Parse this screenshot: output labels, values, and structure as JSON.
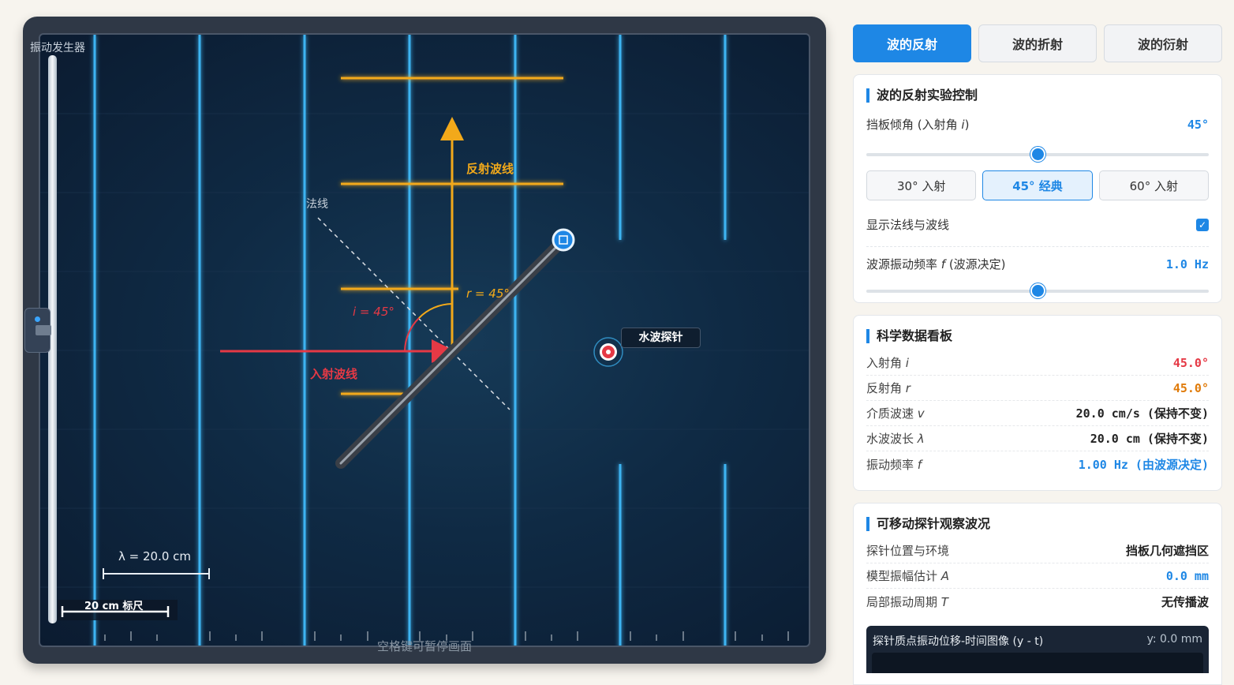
{
  "tank": {
    "generator_label": "振动发生器",
    "hint": "空格键可暂停画面",
    "scale_label": "20 cm 标尺",
    "lambda_label": "λ = 20.0 cm",
    "normal_label": "法线",
    "incident_label": "入射波线",
    "reflected_label": "反射波线",
    "angle_i_label": "i = 45°",
    "angle_r_label": "r = 45°",
    "probe_label": "水波探针",
    "colors": {
      "incident": "#e53945",
      "reflected": "#f2a91a",
      "wave": "#3db4f2"
    }
  },
  "tabs": [
    {
      "label": "波的反射",
      "active": true
    },
    {
      "label": "波的折射",
      "active": false
    },
    {
      "label": "波的衍射",
      "active": false
    }
  ],
  "control": {
    "title": "波的反射实验控制",
    "angle_label_prefix": "挡板倾角 (入射角 ",
    "angle_label_var": "i",
    "angle_label_suffix": ")",
    "angle_value": "45°",
    "angle_level": 0.5,
    "presets": [
      {
        "label": "30° 入射",
        "active": false
      },
      {
        "label": "45° 经典",
        "active": true
      },
      {
        "label": "60° 入射",
        "active": false
      }
    ],
    "show_normal_label": "显示法线与波线",
    "show_normal_checked": true,
    "freq_label_prefix": "波源振动频率 ",
    "freq_label_var": "f",
    "freq_label_suffix": " (波源决定)",
    "freq_value": "1.0 Hz",
    "freq_level": 0.5
  },
  "data_board": {
    "title": "科学数据看板",
    "rows": [
      {
        "label": "入射角 ",
        "var": "i",
        "value": "45.0°",
        "color": "#e53945"
      },
      {
        "label": "反射角 ",
        "var": "r",
        "value": "45.0°",
        "color": "#e07b0a"
      },
      {
        "label": "介质波速 ",
        "var": "v",
        "value": "20.0 cm/s (保持不变)",
        "color": "#222222"
      },
      {
        "label": "水波波长 ",
        "var": "λ",
        "value": "20.0 cm (保持不变)",
        "color": "#222222"
      },
      {
        "label": "振动频率 ",
        "var": "f",
        "value": "1.00 Hz (由波源决定)",
        "color": "#1e87e5"
      }
    ]
  },
  "probe_card": {
    "title": "可移动探针观察波况",
    "rows": [
      {
        "label": "探针位置与环境",
        "var": "",
        "value": "挡板几何遮挡区",
        "color": "#222222",
        "mono": false
      },
      {
        "label": "模型振幅估计 ",
        "var": "A",
        "value": "0.0 mm",
        "color": "#1e87e5",
        "mono": true
      },
      {
        "label": "局部振动周期 ",
        "var": "T",
        "value": "无传播波",
        "color": "#222222",
        "mono": false
      }
    ],
    "graph_title": "探针质点振动位移-时间图像 (y - t)",
    "graph_y": "y: 0.0 mm"
  }
}
